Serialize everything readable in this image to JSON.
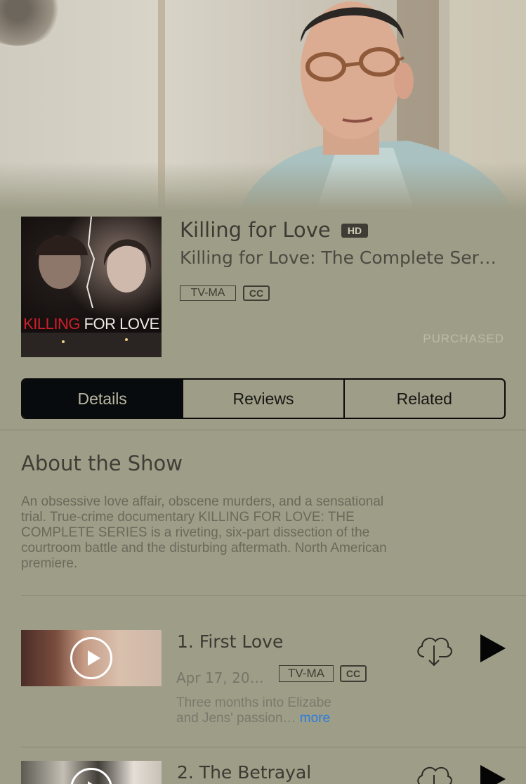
{
  "show": {
    "title": "Killing for Love",
    "quality_badge": "HD",
    "subtitle": "Killing for Love: The Complete Ser…",
    "rating": "TV-MA",
    "cc_badge": "CC",
    "status": "PURCHASED",
    "poster": {
      "title_red": "KILLING",
      "title_white": " FOR LOVE"
    }
  },
  "tabs": [
    {
      "label": "Details",
      "active": true
    },
    {
      "label": "Reviews",
      "active": false
    },
    {
      "label": "Related",
      "active": false
    }
  ],
  "about": {
    "heading": "About the Show",
    "lines": [
      "An obsessive love affair, obscene murders, and a sensational",
      "trial. True-crime documentary KILLING FOR LOVE: THE",
      "COMPLETE SERIES is a riveting, six-part dissection of the",
      "courtroom battle and the disturbing aftermath. North American",
      "premiere."
    ]
  },
  "episodes": [
    {
      "title": "1. First Love",
      "date": "Apr 17, 20…",
      "rating": "TV-MA",
      "cc": "CC",
      "desc_line1": "Three months into Elizabe",
      "desc_line2": "and Jens' passion…",
      "more_label": "more"
    },
    {
      "title": "2. The Betrayal"
    }
  ],
  "icons": {
    "download": "cloud-download-icon",
    "play": "play-icon",
    "play_overlay": "play-circle-icon"
  },
  "colors": {
    "background": "#9e9d87",
    "active_tab": "#070b0d",
    "link": "#2a7de1"
  }
}
